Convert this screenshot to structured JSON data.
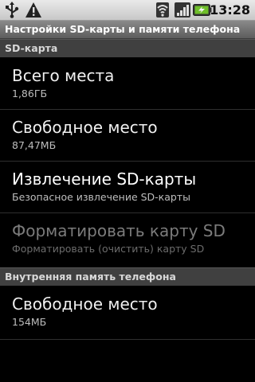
{
  "status_bar": {
    "time": "13:28",
    "icons": [
      "usb-icon",
      "warning-icon",
      "wifi-icon",
      "signal-icon",
      "battery-charging-icon"
    ]
  },
  "title": "Настройки SD-карты и памяти телефона",
  "sections": [
    {
      "header": "SD-карта",
      "items": [
        {
          "title": "Всего места",
          "summary": "1,86ГБ",
          "enabled": true
        },
        {
          "title": "Свободное место",
          "summary": "87,47МБ",
          "enabled": true
        },
        {
          "title": "Извлечение SD-карты",
          "summary": "Безопасное извлечение SD-карты",
          "enabled": true
        },
        {
          "title": "Форматировать карту SD",
          "summary": "Форматировать (очистить) карту SD",
          "enabled": false
        }
      ]
    },
    {
      "header": "Внутренняя память телефона",
      "items": [
        {
          "title": "Свободное место",
          "summary": "154МБ",
          "enabled": true
        }
      ]
    }
  ],
  "colors": {
    "background": "#000000",
    "status_bar": "#d6d6d6",
    "title_bar": "#737373",
    "section_header": "#404040",
    "battery_accent": "#6fbf2a"
  }
}
